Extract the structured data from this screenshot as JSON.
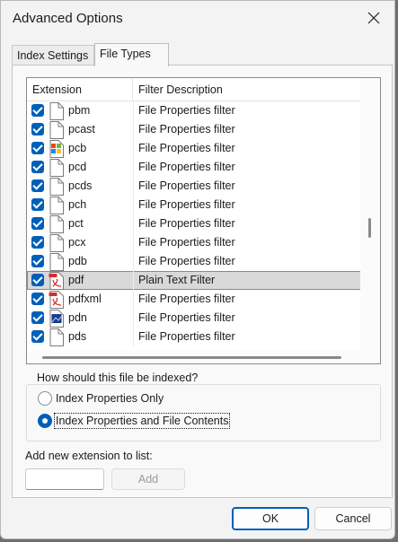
{
  "window": {
    "title": "Advanced Options",
    "close_icon": "close-icon"
  },
  "tabs": [
    {
      "label": "Index Settings",
      "active": false
    },
    {
      "label": "File Types",
      "active": true
    }
  ],
  "list": {
    "columns": [
      "Extension",
      "Filter Description"
    ],
    "rows": [
      {
        "ext": "pbm",
        "desc": "File Properties filter",
        "checked": true,
        "icon": "blank-file-icon"
      },
      {
        "ext": "pcast",
        "desc": "File Properties filter",
        "checked": true,
        "icon": "blank-file-icon"
      },
      {
        "ext": "pcb",
        "desc": "File Properties filter",
        "checked": true,
        "icon": "app-file-icon"
      },
      {
        "ext": "pcd",
        "desc": "File Properties filter",
        "checked": true,
        "icon": "blank-file-icon"
      },
      {
        "ext": "pcds",
        "desc": "File Properties filter",
        "checked": true,
        "icon": "blank-file-icon"
      },
      {
        "ext": "pch",
        "desc": "File Properties filter",
        "checked": true,
        "icon": "blank-file-icon"
      },
      {
        "ext": "pct",
        "desc": "File Properties filter",
        "checked": true,
        "icon": "blank-file-icon"
      },
      {
        "ext": "pcx",
        "desc": "File Properties filter",
        "checked": true,
        "icon": "blank-file-icon"
      },
      {
        "ext": "pdb",
        "desc": "File Properties filter",
        "checked": true,
        "icon": "blank-file-icon"
      },
      {
        "ext": "pdf",
        "desc": "Plain Text Filter",
        "checked": true,
        "icon": "pdf-file-icon",
        "selected": true
      },
      {
        "ext": "pdfxml",
        "desc": "File Properties filter",
        "checked": true,
        "icon": "pdf-file-icon"
      },
      {
        "ext": "pdn",
        "desc": "File Properties filter",
        "checked": true,
        "icon": "image-file-icon"
      },
      {
        "ext": "pds",
        "desc": "File Properties filter",
        "checked": true,
        "icon": "blank-file-icon"
      }
    ]
  },
  "index_group": {
    "label": "How should this file be indexed?",
    "options": [
      {
        "label": "Index Properties Only",
        "selected": false
      },
      {
        "label": "Index Properties and File Contents",
        "selected": true
      }
    ]
  },
  "add_extension": {
    "label": "Add new extension to list:",
    "value": "",
    "button_label": "Add"
  },
  "footer": {
    "ok_label": "OK",
    "cancel_label": "Cancel"
  },
  "colors": {
    "accent": "#005fb8",
    "selection": "#d9d9d9"
  }
}
